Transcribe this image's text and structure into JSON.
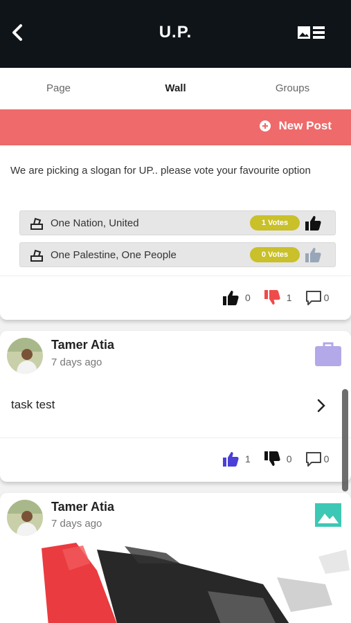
{
  "header": {
    "title": "U.P.",
    "back_icon": "back-chevron-icon",
    "menu_icon": "image-list-icon"
  },
  "tabs": [
    {
      "label": "Page",
      "active": false
    },
    {
      "label": "Wall",
      "active": true
    },
    {
      "label": "Groups",
      "active": false
    }
  ],
  "new_post": {
    "label": "New Post",
    "icon": "plus-circle-icon",
    "color": "#ef6a6a"
  },
  "poll_post": {
    "question": "We are picking a slogan for UP.. please vote your favourite option",
    "options": [
      {
        "label": "One Nation, United",
        "votes": "1 Votes",
        "voted": true
      },
      {
        "label": "One Palestine, One People",
        "votes": "0 Votes",
        "voted": false
      }
    ],
    "likes": "0",
    "dislikes": "1",
    "comments": "0"
  },
  "task_post": {
    "author": "Tamer Atia",
    "time": "7 days ago",
    "text": "task test",
    "type_icon": "briefcase-icon",
    "type_color": "#b3a8e8",
    "likes": "1",
    "dislikes": "0",
    "comments": "0"
  },
  "image_post": {
    "author": "Tamer Atia",
    "time": "7 days ago",
    "type_icon": "image-icon",
    "type_color": "#3cc8b4"
  },
  "colors": {
    "header_bg": "#0f1419",
    "accent_red": "#ef6a6a",
    "vote_badge": "#c9c02a",
    "like_blue": "#4a3fd6"
  }
}
